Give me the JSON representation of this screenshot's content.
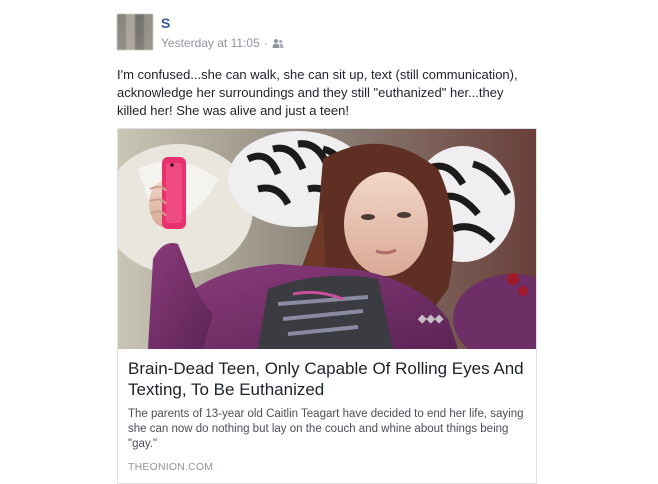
{
  "post": {
    "author": "S",
    "timestamp": "Yesterday at 11:05",
    "separator": "·",
    "audience_icon": "friends-icon",
    "text": "I'm confused...she can walk, she can sit up, text (still communication), acknowledge her surroundings and they still \"euthanized\" her...they killed her! She was alive and just a teen!"
  },
  "link_card": {
    "image_icon": "news-photo",
    "title": "Brain-Dead Teen, Only Capable Of Rolling Eyes And Texting, To Be Euthanized",
    "description": "The parents of 13-year old Caitlin Teagart have decided to end her life, saying she can now do nothing but lay on the couch and whine about things being \"gay.\"",
    "domain": "THEONION.COM"
  },
  "colors": {
    "author_link": "#365899",
    "meta_gray": "#90949c",
    "card_border": "#dddfe2"
  }
}
